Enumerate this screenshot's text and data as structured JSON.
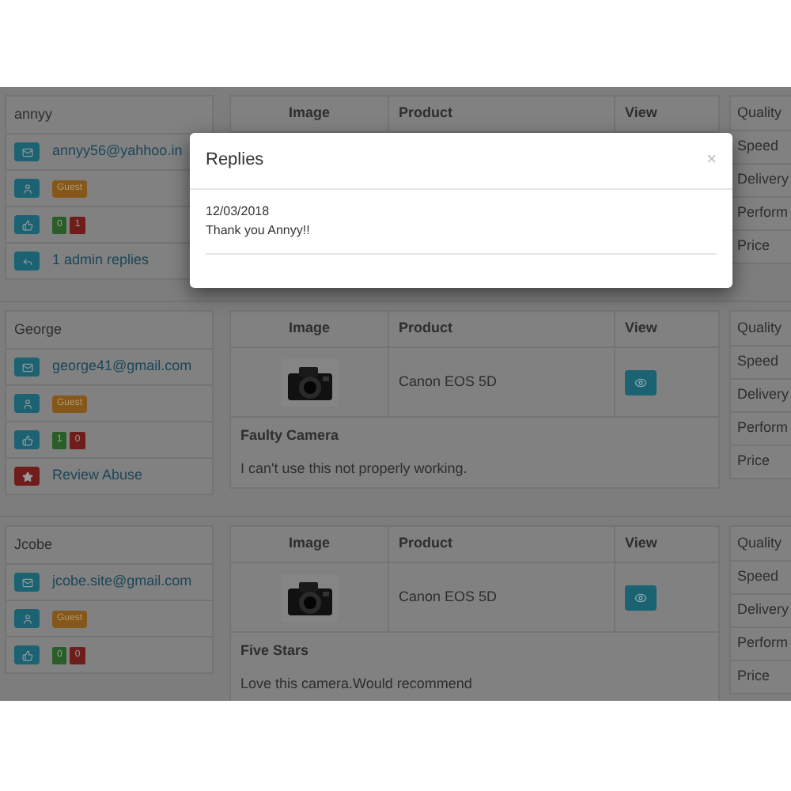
{
  "reviews": [
    {
      "user": {
        "name": "annyy",
        "email": "annyy56@yahhoo.in",
        "role": "Guest",
        "up": "0",
        "down": "1",
        "action": {
          "kind": "replies",
          "text": "1 admin replies"
        }
      },
      "columns": [
        "Image",
        "Product",
        "View"
      ],
      "ratings": [
        "Quality",
        "Speed",
        "Delivery",
        "Perform",
        "Price"
      ]
    },
    {
      "user": {
        "name": "George",
        "email": "george41@gmail.com",
        "role": "Guest",
        "up": "1",
        "down": "0",
        "action": {
          "kind": "abuse",
          "text": "Review Abuse"
        }
      },
      "columns": [
        "Image",
        "Product",
        "View"
      ],
      "product": "Canon EOS 5D",
      "title": "Faulty Camera",
      "body": "I can't use this not properly working.",
      "ratings": [
        "Quality",
        "Speed",
        "Delivery",
        "Perform",
        "Price"
      ]
    },
    {
      "user": {
        "name": "Jcobe",
        "email": "jcobe.site@gmail.com",
        "role": "Guest",
        "up": "0",
        "down": "0"
      },
      "columns": [
        "Image",
        "Product",
        "View"
      ],
      "product": "Canon EOS 5D",
      "title": "Five Stars",
      "body": "Love this camera.Would recommend",
      "ratings": [
        "Quality",
        "Speed",
        "Delivery",
        "Perform",
        "Price"
      ]
    }
  ],
  "modal": {
    "title": "Replies",
    "close": "×",
    "date": "12/03/2018",
    "message": "Thank you Annyy!!"
  }
}
